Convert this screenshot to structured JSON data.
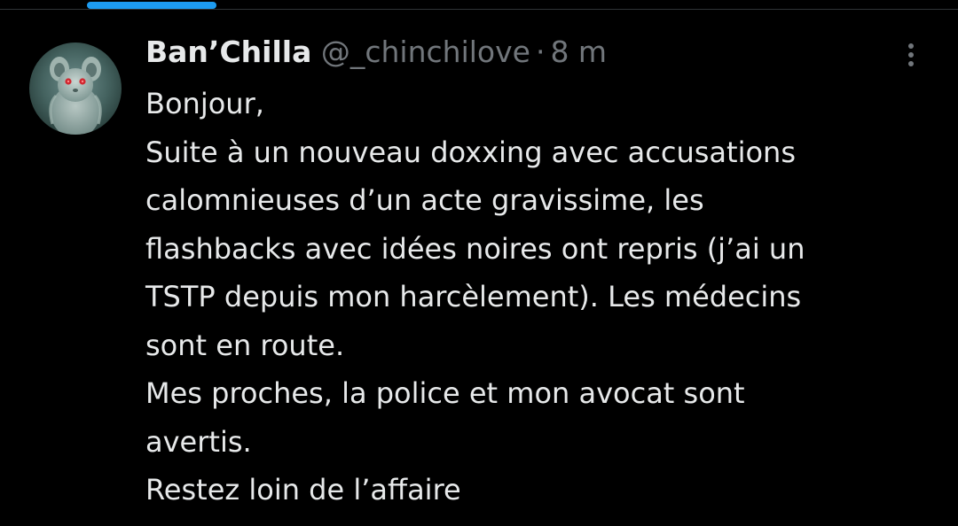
{
  "tweet": {
    "author": {
      "display_name": "Ban’Chilla",
      "handle": "@_chinchilove",
      "avatar_icon": "chinchilla-avatar-icon"
    },
    "separator": "·",
    "timestamp": "8 m",
    "more_icon": "more-vertical-icon",
    "text_lines": [
      "Bonjour,",
      "Suite à un nouveau doxxing avec accusations",
      "calomnieuses d’un acte gravissime, les",
      "flashbacks avec idées noires ont repris (j’ai un",
      "TSTP depuis mon harcèlement). Les médecins",
      "sont en route.",
      "Mes proches, la police et mon avocat sont",
      "avertis.",
      "Restez loin de l’affaire"
    ]
  },
  "colors": {
    "background": "#000000",
    "text": "#e7e9ea",
    "secondary": "#71767b",
    "accent": "#1d9bf0",
    "divider": "#2f3336"
  }
}
